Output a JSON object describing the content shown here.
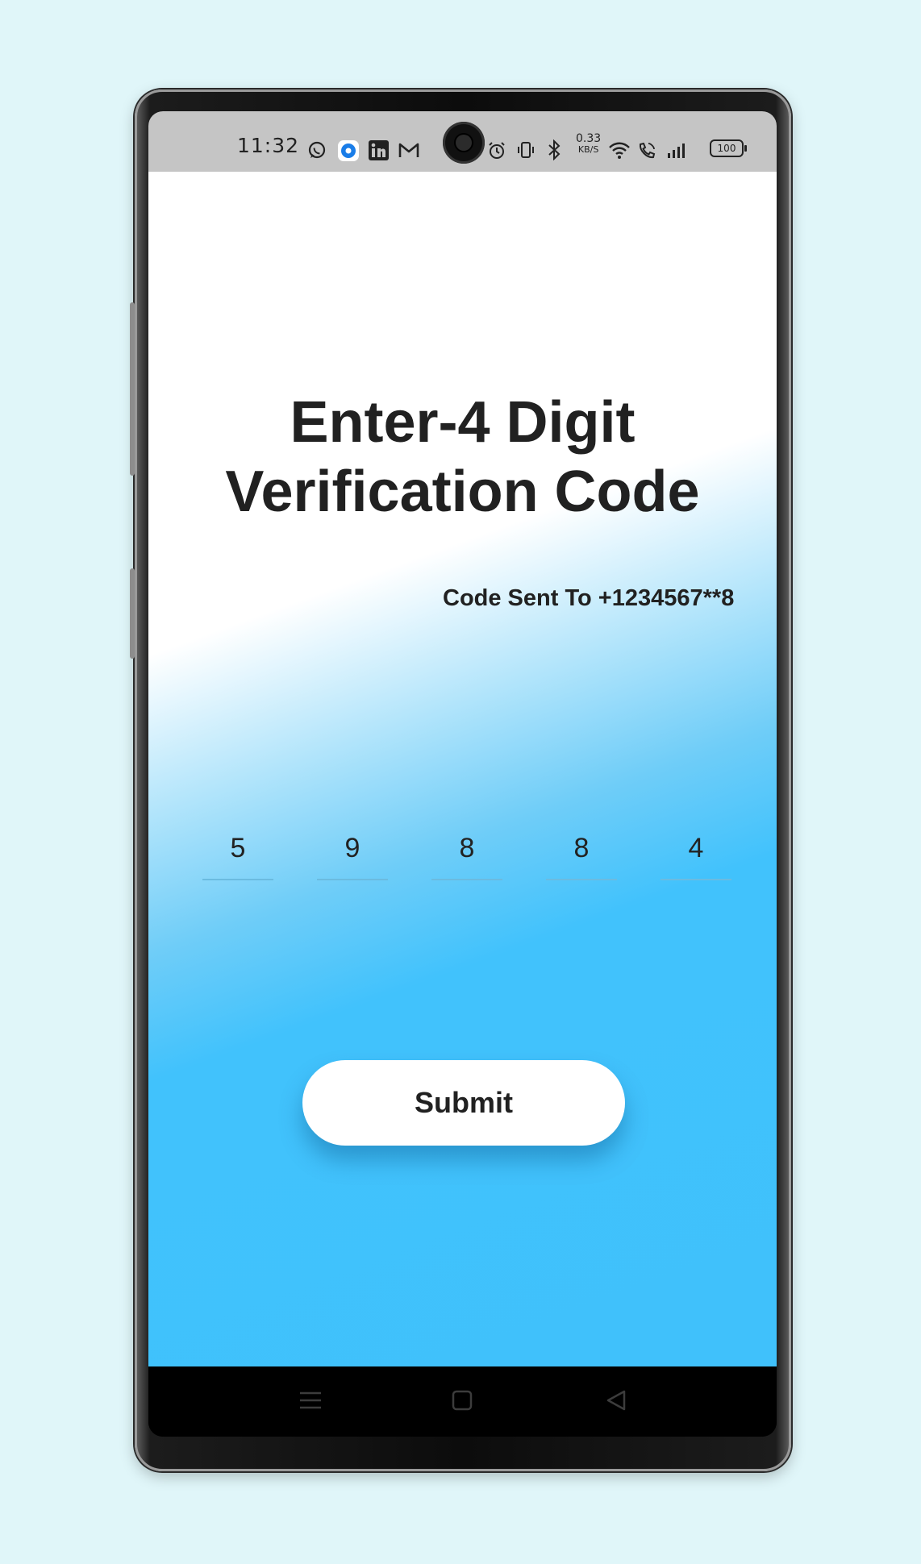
{
  "status_bar": {
    "time": "11:32",
    "net_speed_value": "0.33",
    "net_speed_unit": "KB/S",
    "battery": "100",
    "icons": [
      "whatsapp-icon",
      "messenger-icon",
      "linkedin-icon",
      "gmail-icon",
      "alarm-icon",
      "vibrate-icon",
      "bluetooth-icon",
      "wifi-icon",
      "wifi-calling-icon",
      "signal-icon",
      "battery-icon"
    ]
  },
  "screen": {
    "title_line1": "Enter-4 Digit",
    "title_line2": "Verification Code",
    "code_sent": "Code Sent To +1234567**8",
    "digits": [
      "5",
      "9",
      "8",
      "8",
      "4"
    ],
    "submit_label": "Submit"
  },
  "nav": {
    "icons": [
      "recent-apps-icon",
      "home-icon",
      "back-icon"
    ]
  },
  "colors": {
    "background": "#e0f6f9",
    "gradient_blue": "#40c1fb",
    "text": "#212121",
    "statusbar": "#c5c5c5"
  }
}
